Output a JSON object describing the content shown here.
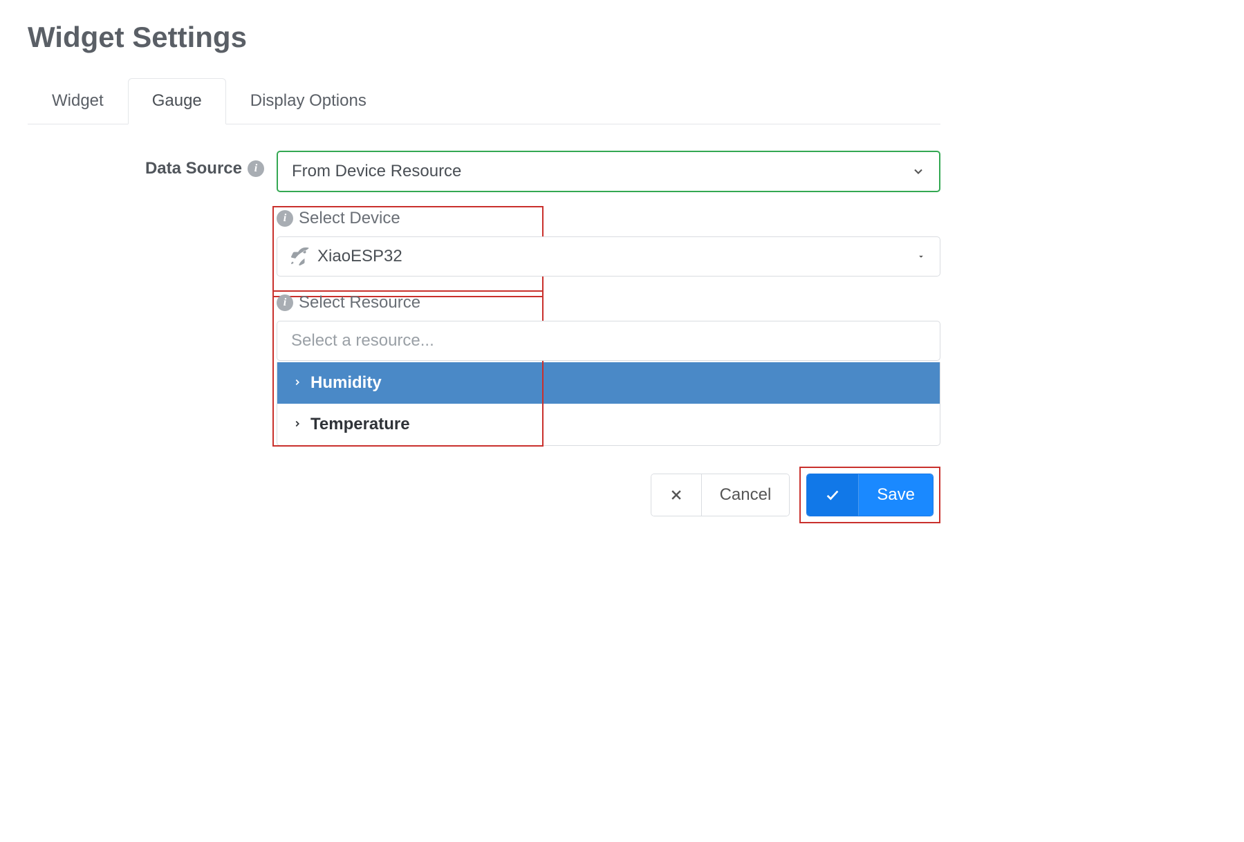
{
  "title": "Widget Settings",
  "tabs": {
    "widget": "Widget",
    "gauge": "Gauge",
    "display_options": "Display Options"
  },
  "form": {
    "data_source": {
      "label": "Data Source",
      "value": "From Device Resource"
    },
    "select_device": {
      "label": "Select Device",
      "value": "XiaoESP32"
    },
    "select_resource": {
      "label": "Select Resource",
      "placeholder": "Select a resource...",
      "options": {
        "humidity": "Humidity",
        "temperature": "Temperature"
      }
    }
  },
  "buttons": {
    "cancel": "Cancel",
    "save": "Save"
  }
}
